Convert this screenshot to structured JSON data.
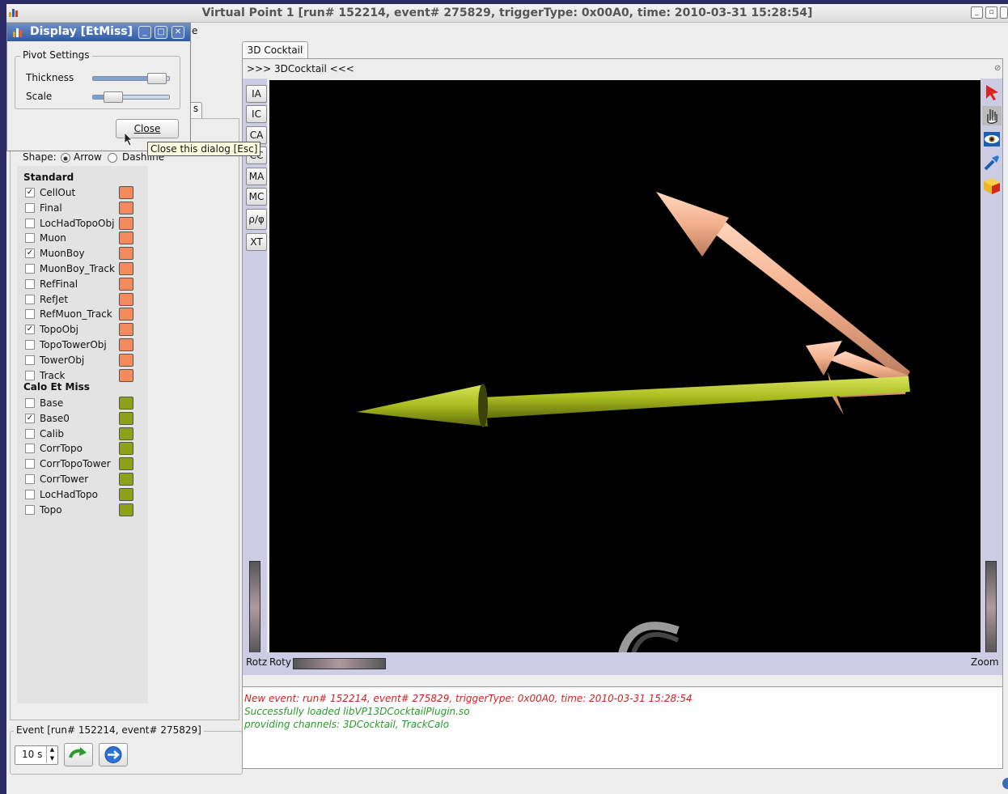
{
  "main_window": {
    "title": "Virtual Point 1 [run# 152214, event# 275829, triggerType: 0x00A0, time: 2010-03-31 15:28:54]"
  },
  "dialog": {
    "title": "Display [EtMiss]",
    "pivot_group_label": "Pivot Settings",
    "thickness_label": "Thickness",
    "thickness_level": 0.95,
    "scale_label": "Scale",
    "scale_level": 0.2,
    "close_label": "Close",
    "tooltip": "Close this dialog [Esc]"
  },
  "left_panel": {
    "partial_tab_glyph": "s",
    "shape_label": "Shape:",
    "shape_options": [
      "Arrow",
      "Dashline"
    ],
    "shape_selected": "Arrow",
    "standard_title": "Standard",
    "standard_color": "#f58a5c",
    "standard_items": [
      {
        "label": "CellOut",
        "checked": true
      },
      {
        "label": "Final",
        "checked": false
      },
      {
        "label": "LocHadTopoObj",
        "checked": false
      },
      {
        "label": "Muon",
        "checked": false
      },
      {
        "label": "MuonBoy",
        "checked": true
      },
      {
        "label": "MuonBoy_Track",
        "checked": false
      },
      {
        "label": "RefFinal",
        "checked": false
      },
      {
        "label": "RefJet",
        "checked": false
      },
      {
        "label": "RefMuon_Track",
        "checked": false
      },
      {
        "label": "TopoObj",
        "checked": true
      },
      {
        "label": "TopoTowerObj",
        "checked": false
      },
      {
        "label": "TowerObj",
        "checked": false
      },
      {
        "label": "Track",
        "checked": false
      }
    ],
    "calo_title": "Calo Et Miss",
    "calo_color": "#8ea11b",
    "calo_items": [
      {
        "label": "Base",
        "checked": false
      },
      {
        "label": "Base0",
        "checked": true
      },
      {
        "label": "Calib",
        "checked": false
      },
      {
        "label": "CorrTopo",
        "checked": false
      },
      {
        "label": "CorrTopoTower",
        "checked": false
      },
      {
        "label": "CorrTower",
        "checked": false
      },
      {
        "label": "LocHadTopo",
        "checked": false
      },
      {
        "label": "Topo",
        "checked": false
      }
    ]
  },
  "event_box": {
    "title": "Event [run# 152214, event# 275829]",
    "interval_value": "10 s"
  },
  "viewer": {
    "tab_label": "3D Cocktail",
    "subtitle": ">>> 3DCocktail <<<",
    "side_buttons": [
      "IA",
      "IC",
      "CA",
      "CC",
      "MA",
      "MC",
      "ρ/φ",
      "XT"
    ],
    "right_tools": [
      "select-arrow-icon",
      "hand-icon",
      "eye-icon",
      "flashlight-icon",
      "view-all-icon"
    ],
    "rotz_label": "Rotz",
    "roty_label": "Roty",
    "zoom_label": "Zoom",
    "pink_arrow_color": "#f3b08d",
    "green_arrow_color": "#a9bc1f"
  },
  "messages": [
    {
      "text": "New event: run# 152214, event# 275829, triggerType: 0x00A0, time: 2010-03-31 15:28:54",
      "color": "#cc2222"
    },
    {
      "text": "Successfully loaded libVP13DCocktailPlugin.so",
      "color": "#2a9a2a"
    },
    {
      "text": "providing channels: 3DCocktail, TrackCalo",
      "color": "#2a9a2a"
    }
  ]
}
